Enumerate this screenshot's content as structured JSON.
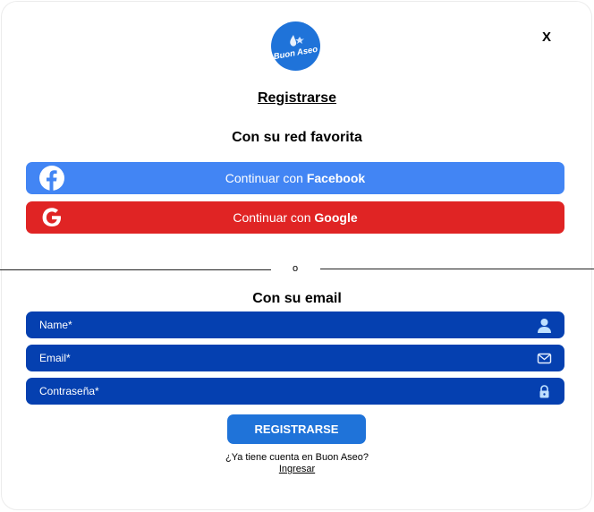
{
  "header": {
    "logo_text": "Buon Aseo",
    "close_label": "X",
    "title": "Registrarse"
  },
  "social": {
    "heading": "Con su red favorita",
    "facebook": {
      "prefix": "Continuar con ",
      "brand": "Facebook",
      "color": "#4285f4"
    },
    "google": {
      "prefix": "Continuar con ",
      "brand": "Google",
      "color": "#e02424"
    }
  },
  "divider": {
    "label": "o"
  },
  "email": {
    "heading": "Con su email",
    "fields": [
      {
        "label": "Name*",
        "icon": "user-icon"
      },
      {
        "label": "Email*",
        "icon": "envelope-icon"
      },
      {
        "label": "Contraseña*",
        "icon": "lock-icon"
      }
    ],
    "field_color": "#0540b0"
  },
  "actions": {
    "submit_label": "REGISTRARSE",
    "have_account": "¿Ya tiene cuenta en Buon Aseo?",
    "login_label": "Ingresar"
  }
}
